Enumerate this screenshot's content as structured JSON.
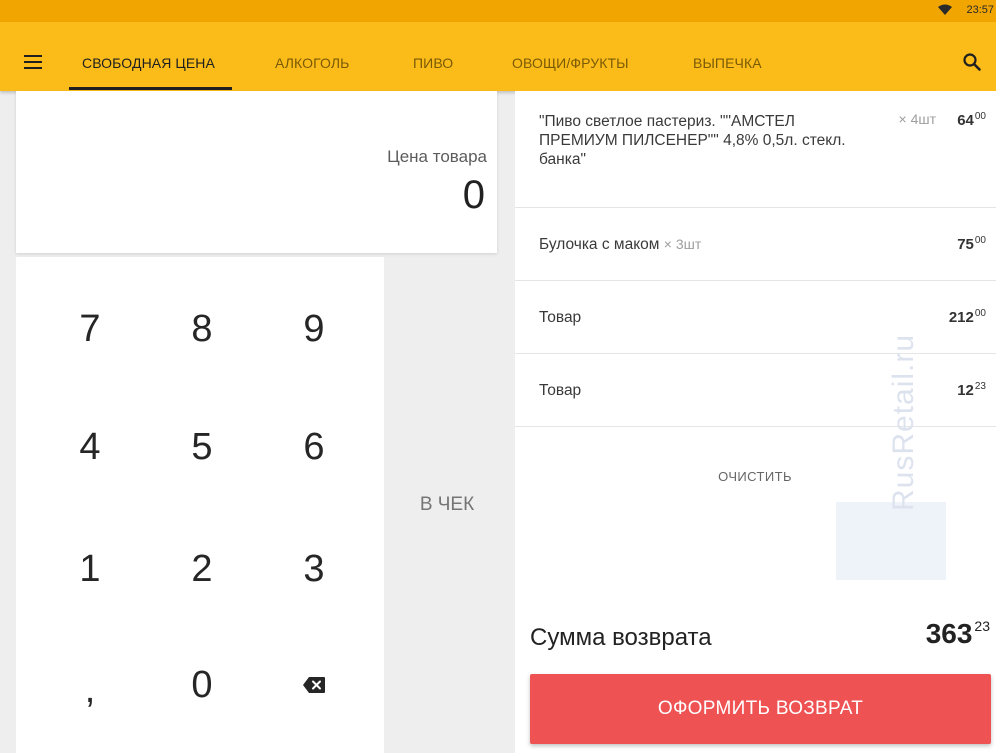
{
  "status_bar": {
    "time": "23:57",
    "icons": [
      "wifi-icon"
    ]
  },
  "toolbar": {
    "menu_icon": "menu-icon",
    "search_icon": "search-icon",
    "tabs": [
      {
        "label": "СВОБОДНАЯ ЦЕНА",
        "active": true
      },
      {
        "label": "АЛКОГОЛЬ",
        "active": false
      },
      {
        "label": "ПИВО",
        "active": false
      },
      {
        "label": "ОВОЩИ/ФРУКТЫ",
        "active": false
      },
      {
        "label": "ВЫПЕЧКА",
        "active": false
      }
    ]
  },
  "price_entry": {
    "label": "Цена товара",
    "value": "0"
  },
  "keypad": {
    "keys": [
      "7",
      "8",
      "9",
      "4",
      "5",
      "6",
      "1",
      "2",
      "3",
      ",",
      "0"
    ],
    "backspace_icon": "backspace-icon",
    "add_to_receipt_label": "В ЧЕК"
  },
  "receipt": {
    "items": [
      {
        "name": "\"Пиво светлое пастериз. \"\"АМСТЕЛ ПРЕМИУМ ПИЛСЕНЕР\"\" 4,8% 0,5л. стекл. банка\"",
        "qty": "× 4шт",
        "amount_main": "64",
        "amount_cents": "00"
      },
      {
        "name": "Булочка с маком",
        "qty": "× 3шт",
        "amount_main": "75",
        "amount_cents": "00"
      },
      {
        "name": "Товар",
        "qty": "",
        "amount_main": "212",
        "amount_cents": "00"
      },
      {
        "name": "Товар",
        "qty": "",
        "amount_main": "12",
        "amount_cents": "23"
      }
    ],
    "clear_label": "ОЧИСТИТЬ",
    "watermark": "RusRetail.ru",
    "total_label": "Сумма возврата",
    "total_main": "363",
    "total_cents": "23",
    "submit_label": "ОФОРМИТЬ ВОЗВРАТ"
  },
  "colors": {
    "status_bar": "#f0a500",
    "toolbar": "#fbbc1a",
    "submit_button": "#ee5253"
  }
}
